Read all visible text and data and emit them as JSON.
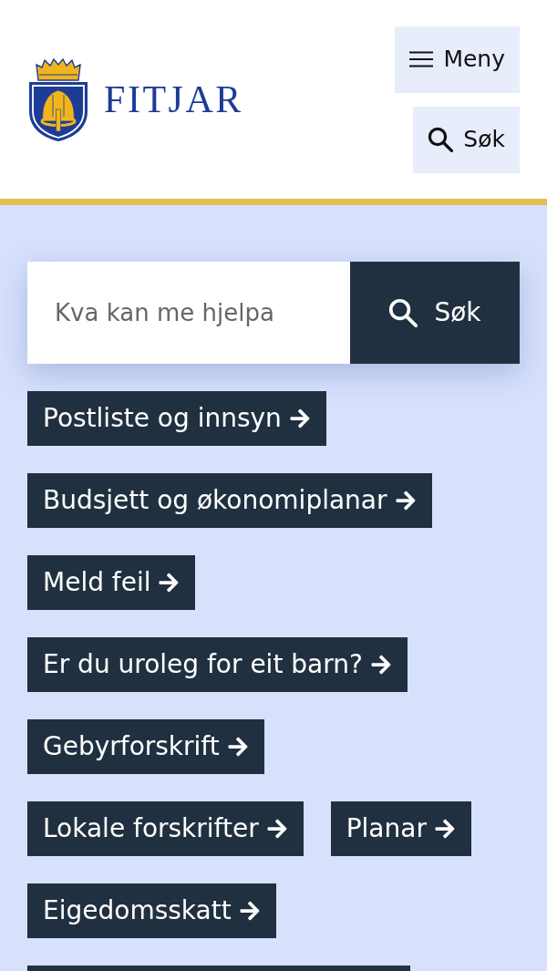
{
  "header": {
    "logo": {
      "text": "FITJAR"
    },
    "buttons": [
      {
        "kind": "menu",
        "label": "Meny"
      },
      {
        "kind": "search",
        "label": "Søk"
      }
    ]
  },
  "search": {
    "placeholder": "Kva kan me hjelpa",
    "button": "Søk"
  },
  "quick_links": [
    "Postliste og innsyn",
    "Budsjett og økonomiplanar",
    "Meld feil",
    "Er du uroleg for eit barn?",
    "Gebyrforskrift",
    "Lokale forskrifter",
    "Planar",
    "Eigedomsskatt"
  ]
}
